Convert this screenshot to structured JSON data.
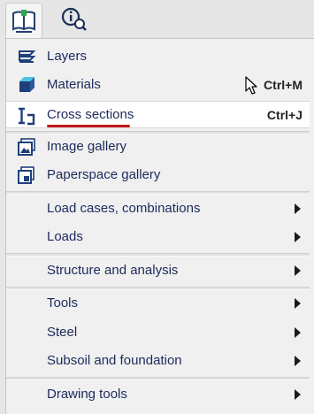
{
  "toolbar": {
    "main_icon": "book-icon",
    "help_icon": "info-search-icon"
  },
  "menu": {
    "items": [
      {
        "label": "Layers",
        "icon": "layers-icon"
      },
      {
        "label": "Materials",
        "shortcut": "Ctrl+M",
        "icon": "materials-icon"
      },
      {
        "label": "Cross sections",
        "shortcut": "Ctrl+J",
        "icon": "cross-section-icon"
      },
      {
        "label": "Image gallery",
        "icon": "image-gallery-icon"
      },
      {
        "label": "Paperspace gallery",
        "icon": "paperspace-gallery-icon"
      },
      {
        "label": "Load cases, combinations"
      },
      {
        "label": "Loads"
      },
      {
        "label": "Structure and analysis"
      },
      {
        "label": "Tools"
      },
      {
        "label": "Steel"
      },
      {
        "label": "Subsoil and foundation"
      },
      {
        "label": "Drawing tools"
      }
    ]
  },
  "colors": {
    "accent_red": "#c01818",
    "label_text": "#1d2a5b",
    "icon_blue": "#1f3f7a"
  }
}
